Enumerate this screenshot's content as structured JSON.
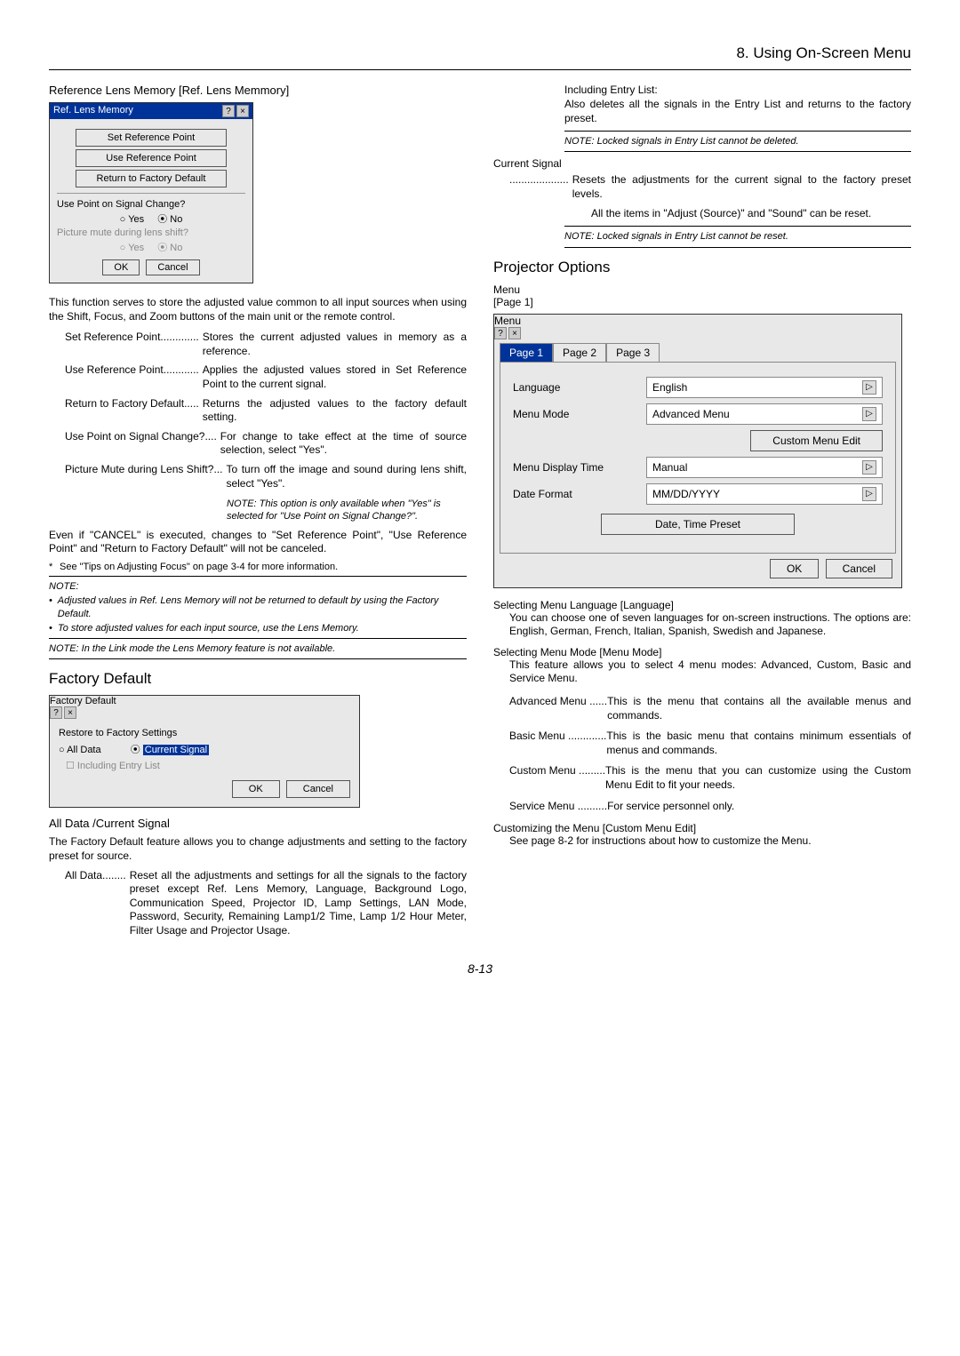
{
  "header": {
    "chapter": "8. Using On-Screen Menu"
  },
  "left": {
    "refLensHeading": "Reference Lens Memory [Ref. Lens Memmory]",
    "dialog1": {
      "title": "Ref. Lens Memory",
      "btnSetRef": "Set Reference Point",
      "btnUseRef": "Use Reference Point",
      "btnReturn": "Return to Factory Default",
      "q1": "Use Point on Signal Change?",
      "q1yes": "Yes",
      "q1no": "No",
      "q2": "Picture mute during lens shift?",
      "q2yes": "Yes",
      "q2no": "No",
      "ok": "OK",
      "cancel": "Cancel"
    },
    "para1": "This function serves to store the adjusted value common to all input sources when using the Shift, Focus, and Zoom buttons of the main unit or the remote control.",
    "defs": {
      "t1": "Set Reference Point",
      "d1dots": " ............. ",
      "d1": "Stores the current adjusted values in memory as a reference.",
      "t2": "Use Reference Point",
      "d2dots": " ............ ",
      "d2": "Applies the adjusted values stored in Set Reference Point to the current signal.",
      "t3": "Return to Factory Default",
      "d3dots": " ..... ",
      "d3": "Returns the adjusted values to the factory default setting.",
      "t4": "Use Point on Signal Change?",
      "d4dots": " .... ",
      "d4": "For change to take effect at the time of source selection, select \"Yes\".",
      "t5": "Picture Mute during Lens Shift?",
      "d5dots": " ... ",
      "d5": "To turn off the image and sound during lens shift, select \"Yes\".",
      "d5note": "NOTE: This option is only available when \"Yes\" is selected for \"Use Point on Signal Change?\"."
    },
    "para2": "Even if \"CANCEL\" is executed, changes to \"Set Reference Point\", \"Use Reference Point\" and \"Return to Factory Default\" will not be canceled.",
    "ast": "See \"Tips on Adjusting Focus\" on page 3-4 for more information.",
    "noteLabel": "NOTE:",
    "noteB1": "Adjusted values in Ref. Lens Memory will not be returned to default by using the Factory Default.",
    "noteB2": "To store adjusted values for each input source, use the Lens Memory.",
    "note2": "NOTE: In the Link mode the Lens Memory feature is not available.",
    "factoryH": "Factory Default",
    "dialog2": {
      "title": "Factory Default",
      "restore": "Restore to Factory Settings",
      "optAll": "All Data",
      "optCur": "Current Signal",
      "chk": "Including Entry List",
      "ok": "OK",
      "cancel": "Cancel"
    },
    "adsHeading": "All Data /Current Signal",
    "para3": "The Factory Default feature allows you to change adjustments and setting to the factory preset for source.",
    "allData_t": "All Data",
    "allData_dots": " ........ ",
    "allData_d": "Reset all the adjustments and settings for all the signals to the factory preset except Ref. Lens Memory, Language, Background Logo, Communication Speed, Projector ID, Lamp Settings, LAN Mode, Password, Security, Remaining Lamp1/2 Time, Lamp 1/2 Hour Meter, Filter Usage and Projector Usage."
  },
  "right": {
    "incEntry": "Including Entry List:",
    "incEntryDesc": "Also deletes all the signals in the Entry List and returns to the factory preset.",
    "noteDel": "NOTE: Locked signals in Entry List cannot be deleted.",
    "curSig": "Current Signal",
    "resetDots": "....................",
    "resetDesc": "Resets the adjustments for the current signal to the factory preset levels.",
    "resetDesc2": "All the items in \"Adjust (Source)\" and \"Sound\" can be reset.",
    "noteReset": "NOTE: Locked signals in Entry List cannot be reset.",
    "projOptH": "Projector Options",
    "menuLbl": "Menu",
    "pageLbl": "[Page 1]",
    "menuDialog": {
      "title": "Menu",
      "tab1": "Page 1",
      "tab2": "Page 2",
      "tab3": "Page 3",
      "langLbl": "Language",
      "langVal": "English",
      "modeLbl": "Menu Mode",
      "modeVal": "Advanced Menu",
      "customBtn": "Custom Menu Edit",
      "dispLbl": "Menu Display Time",
      "dispVal": "Manual",
      "dateLbl": "Date Format",
      "dateVal": "MM/DD/YYYY",
      "presetBtn": "Date, Time Preset",
      "ok": "OK",
      "cancel": "Cancel"
    },
    "selLangH": "Selecting Menu Language [Language]",
    "selLangP": "You can choose one of seven languages for on-screen instructions. The options are: English, German, French, Italian, Spanish, Swedish and Japanese.",
    "selModeH": "Selecting Menu Mode [Menu Mode]",
    "selModeP": "This feature allows you to select 4 menu modes: Advanced, Custom, Basic and Service Menu.",
    "menuDefs": {
      "t1": "Advanced Menu",
      "d1dots": " ...... ",
      "d1": "This is the menu that contains all the available menus and commands.",
      "t2": "Basic Menu",
      "d2dots": " ............. ",
      "d2": "This is the basic menu that contains minimum essentials of menus and commands.",
      "t3": "Custom Menu",
      "d3dots": " ......... ",
      "d3": "This is the menu that you can customize using the Custom Menu Edit to fit your needs.",
      "t4": "Service Menu",
      "d4dots": " .......... ",
      "d4": "For service personnel only."
    },
    "custH": "Customizing the Menu [Custom Menu Edit]",
    "custP": "See page 8-2 for instructions about how to customize the Menu."
  },
  "pageNum": "8-13"
}
